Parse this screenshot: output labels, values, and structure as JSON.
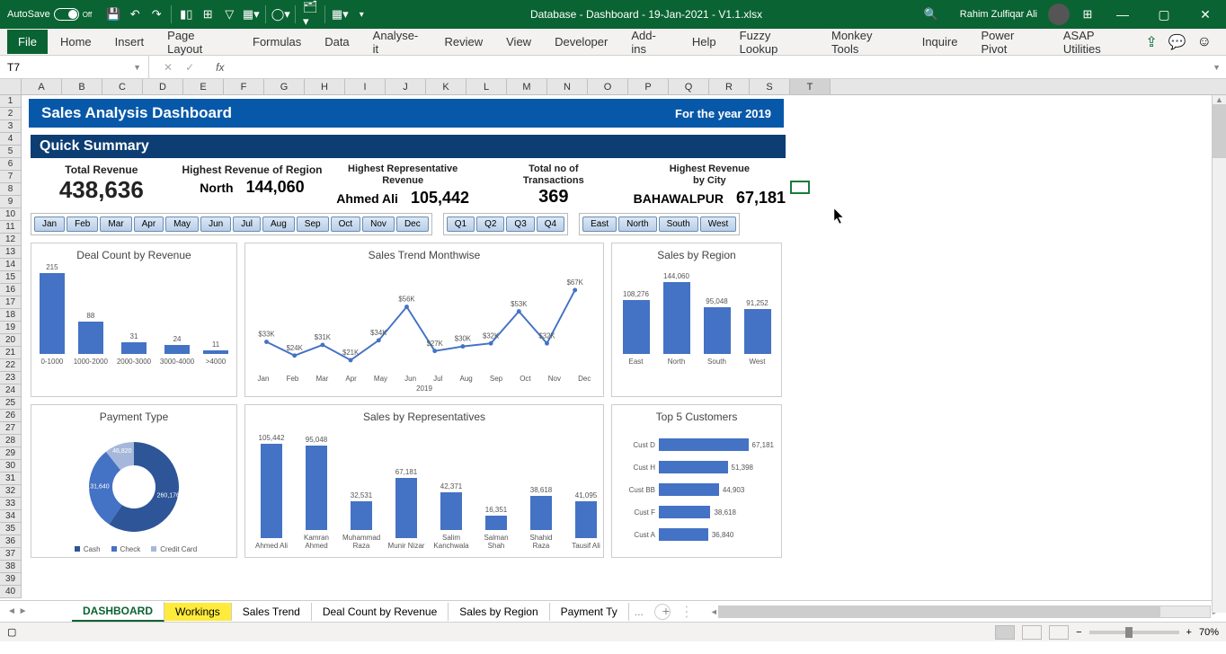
{
  "app": {
    "autosave_label": "AutoSave",
    "autosave_state": "Off",
    "doc_title": "Database - Dashboard - 19-Jan-2021 - V1.1.xlsx",
    "user_name": "Rahim Zulfiqar Ali"
  },
  "ribbon": {
    "tabs": [
      "File",
      "Home",
      "Insert",
      "Page Layout",
      "Formulas",
      "Data",
      "Analyse-it",
      "Review",
      "View",
      "Developer",
      "Add-ins",
      "Help",
      "Fuzzy Lookup",
      "Monkey Tools",
      "Inquire",
      "Power Pivot",
      "ASAP Utilities"
    ]
  },
  "namebox": "T7",
  "sheet_tabs": [
    "DASHBOARD",
    "Workings",
    "Sales Trend",
    "Deal Count by Revenue",
    "Sales by Region",
    "Payment Ty"
  ],
  "sheet_more": "...",
  "zoom": "70%",
  "dashboard": {
    "title": "Sales Analysis Dashboard",
    "year": "For the year 2019",
    "quick_summary": "Quick Summary",
    "cards": {
      "total_rev": {
        "label": "Total Revenue",
        "value": "438,636"
      },
      "hi_region": {
        "label": "Highest Revenue of Region",
        "sub": "North",
        "value": "144,060"
      },
      "hi_rep": {
        "label1": "Highest Representative",
        "label2": "Revenue",
        "sub": "Ahmed Ali",
        "value": "105,442"
      },
      "trans": {
        "label1": "Total no of",
        "label2": "Transactions",
        "value": "369"
      },
      "hi_city": {
        "label1": "Highest Revenue",
        "label2": "by City",
        "sub": "BAHAWALPUR",
        "value": "67,181"
      }
    },
    "months": [
      "Jan",
      "Feb",
      "Mar",
      "Apr",
      "May",
      "Jun",
      "Jul",
      "Aug",
      "Sep",
      "Oct",
      "Nov",
      "Dec"
    ],
    "quarters": [
      "Q1",
      "Q2",
      "Q3",
      "Q4"
    ],
    "regions": [
      "East",
      "North",
      "South",
      "West"
    ]
  },
  "chart_data": [
    {
      "type": "bar",
      "title": "Deal Count by Revenue",
      "categories": [
        "0-1000",
        "1000-2000",
        "2000-3000",
        "3000-4000",
        ">4000"
      ],
      "values": [
        215,
        88,
        31,
        24,
        11
      ]
    },
    {
      "type": "line",
      "title": "Sales Trend Monthwise",
      "categories": [
        "Jan",
        "Feb",
        "Mar",
        "Apr",
        "May",
        "Jun",
        "Jul",
        "Aug",
        "Sep",
        "Oct",
        "Nov",
        "Dec"
      ],
      "labels": [
        "$33K",
        "$24K",
        "$31K",
        "$21K",
        "$34K",
        "$56K",
        "$27K",
        "$30K",
        "$32K",
        "$53K",
        "$32K",
        "$67K"
      ],
      "values": [
        33,
        24,
        31,
        21,
        34,
        56,
        27,
        30,
        32,
        53,
        32,
        67
      ],
      "year_label": "2019"
    },
    {
      "type": "bar",
      "title": "Sales by Region",
      "categories": [
        "East",
        "North",
        "South",
        "West"
      ],
      "values": [
        108276,
        144060,
        95048,
        91252
      ],
      "labels": [
        "108,276",
        "144,060",
        "95,048",
        "91,252"
      ]
    },
    {
      "type": "pie",
      "title": "Payment Type",
      "categories": [
        "Cash",
        "Check",
        "Credit Card"
      ],
      "values": [
        260176,
        131640,
        46820
      ],
      "labels": [
        "260,176",
        "131,640",
        "46,820"
      ]
    },
    {
      "type": "bar",
      "title": "Sales by Representatives",
      "categories": [
        "Ahmed Ali",
        "Kamran Ahmed",
        "Muhammad Raza",
        "Munir Nizar",
        "Salim Kanchwala",
        "Salman Shah",
        "Shahid Raza",
        "Tausif Ali"
      ],
      "values": [
        105442,
        95048,
        32531,
        67181,
        42371,
        16351,
        38618,
        41095
      ],
      "labels": [
        "105,442",
        "95,048",
        "32,531",
        "67,181",
        "42,371",
        "16,351",
        "38,618",
        "41,095"
      ]
    },
    {
      "type": "bar",
      "title": "Top 5 Customers",
      "orientation": "horizontal",
      "categories": [
        "Cust D",
        "Cust H",
        "Cust BB",
        "Cust F",
        "Cust A"
      ],
      "values": [
        67181,
        51398,
        44903,
        38618,
        36840
      ],
      "labels": [
        "67,181",
        "51,398",
        "44,903",
        "38,618",
        "36,840"
      ]
    }
  ]
}
